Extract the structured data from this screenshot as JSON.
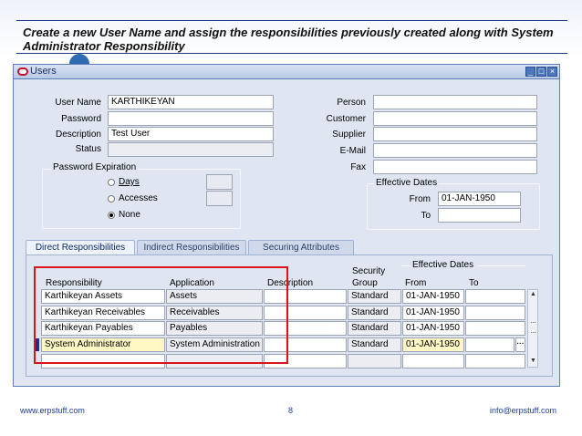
{
  "slide": {
    "title": "Create a new User Name and assign the responsibilities previously created along with System Administrator Responsibility",
    "footer_left": "www.erpstuff.com",
    "footer_page": "8",
    "footer_right": "info@erpstuff.com"
  },
  "window": {
    "title": "Users",
    "icons": {
      "app": "oracle-icon",
      "minimize": "minimize-icon",
      "maximize": "maximize-icon",
      "close": "close-icon"
    }
  },
  "form": {
    "user_name_label": "User Name",
    "user_name_value": "KARTHIKEYAN",
    "password_label": "Password",
    "password_value": "",
    "description_label": "Description",
    "description_value": "Test User",
    "status_label": "Status",
    "status_value": "",
    "person_label": "Person",
    "customer_label": "Customer",
    "supplier_label": "Supplier",
    "email_label": "E-Mail",
    "fax_label": "Fax"
  },
  "password_expiration": {
    "title": "Password Expiration",
    "options": [
      {
        "label": "Days",
        "selected": false
      },
      {
        "label": "Accesses",
        "selected": false
      },
      {
        "label": "None",
        "selected": true
      }
    ]
  },
  "effective_dates": {
    "title": "Effective Dates",
    "from_label": "From",
    "from_value": "01-JAN-1950",
    "to_label": "To",
    "to_value": ""
  },
  "tabs": [
    {
      "label": "Direct Responsibilities",
      "active": true
    },
    {
      "label": "Indirect Responsibilities",
      "active": false
    },
    {
      "label": "Securing Attributes",
      "active": false
    }
  ],
  "responsibilities": {
    "headers": {
      "responsibility": "Responsibility",
      "application": "Application",
      "description": "Description",
      "security_group_line1": "Security",
      "security_group_line2": "Group",
      "effective_dates": "Effective Dates",
      "from": "From",
      "to": "To"
    },
    "rows": [
      {
        "responsibility": "Karthikeyan Assets",
        "application": "Assets",
        "description": "",
        "security_group": "Standard",
        "from": "01-JAN-1950",
        "to": ""
      },
      {
        "responsibility": "Karthikeyan Receivables",
        "application": "Receivables",
        "description": "",
        "security_group": "Standard",
        "from": "01-JAN-1950",
        "to": ""
      },
      {
        "responsibility": "Karthikeyan Payables",
        "application": "Payables",
        "description": "",
        "security_group": "Standard",
        "from": "01-JAN-1950",
        "to": ""
      },
      {
        "responsibility": "System Administrator",
        "application": "System Administration",
        "description": "",
        "security_group": "Standard",
        "from": "01-JAN-1950",
        "to": ""
      },
      {
        "responsibility": "",
        "application": "",
        "description": "",
        "security_group": "",
        "from": "",
        "to": ""
      }
    ],
    "active_row": 3,
    "highlight_color": "#d9141b"
  }
}
